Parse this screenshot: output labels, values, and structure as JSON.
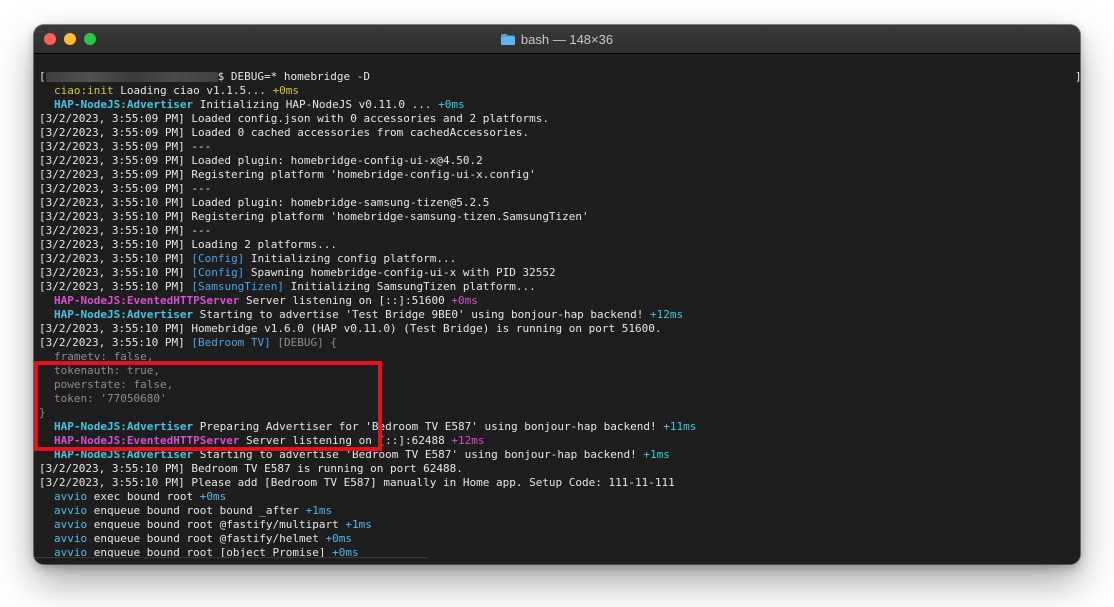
{
  "window": {
    "title": "bash — 148×36",
    "icons": {
      "folder": "folder-icon",
      "close": "close-icon",
      "minimize": "minimize-icon",
      "maximize": "maximize-icon"
    },
    "colors": {
      "highlight": "#e2131f",
      "background": "#1e1e1e"
    }
  },
  "terminal": {
    "prompt_command": "$ DEBUG=* homebridge -D",
    "right_bracket": "]",
    "lines": [
      {
        "indent": true,
        "parts": [
          {
            "t": "ciao:init",
            "c": "c-ciao"
          },
          {
            "t": " Loading ciao v1.1.5... "
          },
          {
            "t": "+0ms",
            "c": "c-ms-y"
          }
        ]
      },
      {
        "indent": true,
        "parts": [
          {
            "t": "HAP-NodeJS:Advertiser",
            "c": "c-adv"
          },
          {
            "t": " Initializing HAP-NodeJS v0.11.0 ... "
          },
          {
            "t": "+0ms",
            "c": "c-ms-c"
          }
        ]
      },
      {
        "parts": [
          {
            "t": "[3/2/2023, 3:55:09 PM] Loaded config.json with 0 accessories and 2 platforms."
          }
        ]
      },
      {
        "parts": [
          {
            "t": "[3/2/2023, 3:55:09 PM] Loaded 0 cached accessories from cachedAccessories."
          }
        ]
      },
      {
        "parts": [
          {
            "t": "[3/2/2023, 3:55:09 PM] ---"
          }
        ]
      },
      {
        "parts": [
          {
            "t": "[3/2/2023, 3:55:09 PM] Loaded plugin: homebridge-config-ui-x@4.50.2"
          }
        ]
      },
      {
        "parts": [
          {
            "t": "[3/2/2023, 3:55:09 PM] Registering platform 'homebridge-config-ui-x.config'"
          }
        ]
      },
      {
        "parts": [
          {
            "t": "[3/2/2023, 3:55:09 PM] ---"
          }
        ]
      },
      {
        "parts": [
          {
            "t": "[3/2/2023, 3:55:10 PM] Loaded plugin: homebridge-samsung-tizen@5.2.5"
          }
        ]
      },
      {
        "parts": [
          {
            "t": "[3/2/2023, 3:55:10 PM] Registering platform 'homebridge-samsung-tizen.SamsungTizen'"
          }
        ]
      },
      {
        "parts": [
          {
            "t": "[3/2/2023, 3:55:10 PM] ---"
          }
        ]
      },
      {
        "parts": [
          {
            "t": "[3/2/2023, 3:55:10 PM] Loading 2 platforms..."
          }
        ]
      },
      {
        "parts": [
          {
            "t": "[3/2/2023, 3:55:10 PM] "
          },
          {
            "t": "[Config]",
            "c": "c-cfg"
          },
          {
            "t": " Initializing config platform..."
          }
        ]
      },
      {
        "parts": [
          {
            "t": "[3/2/2023, 3:55:10 PM] "
          },
          {
            "t": "[Config]",
            "c": "c-cfg"
          },
          {
            "t": " Spawning homebridge-config-ui-x with PID 32552"
          }
        ]
      },
      {
        "parts": [
          {
            "t": "[3/2/2023, 3:55:10 PM] "
          },
          {
            "t": "[SamsungTizen]",
            "c": "c-cfg"
          },
          {
            "t": " Initializing SamsungTizen platform..."
          }
        ]
      },
      {
        "indent": true,
        "parts": [
          {
            "t": "HAP-NodeJS:EventedHTTPServer",
            "c": "c-evt"
          },
          {
            "t": " Server listening on [::]:51600 "
          },
          {
            "t": "+0ms",
            "c": "c-ms-m"
          }
        ]
      },
      {
        "indent": true,
        "parts": [
          {
            "t": "HAP-NodeJS:Advertiser",
            "c": "c-adv"
          },
          {
            "t": " Starting to advertise 'Test Bridge 9BE0' using bonjour-hap backend! "
          },
          {
            "t": "+12ms",
            "c": "c-ms-c"
          }
        ]
      },
      {
        "parts": [
          {
            "t": "[3/2/2023, 3:55:10 PM] Homebridge v1.6.0 (HAP v0.11.0) (Test Bridge) is running on port 51600."
          }
        ]
      },
      {
        "parts": [
          {
            "t": "[3/2/2023, 3:55:10 PM] "
          },
          {
            "t": "[Bedroom TV]",
            "c": "c-cfg"
          },
          {
            "t": " [DEBUG] {",
            "c": "c-gray"
          }
        ]
      },
      {
        "indent": true,
        "parts": [
          {
            "t": "frametv: false,",
            "c": "c-gray"
          }
        ]
      },
      {
        "indent": true,
        "parts": [
          {
            "t": "tokenauth: true,",
            "c": "c-gray"
          }
        ]
      },
      {
        "indent": true,
        "parts": [
          {
            "t": "powerstate: false,",
            "c": "c-gray"
          }
        ]
      },
      {
        "indent": true,
        "parts": [
          {
            "t": "token: '77050680'",
            "c": "c-gray"
          }
        ]
      },
      {
        "parts": [
          {
            "t": "}",
            "c": "c-gray"
          }
        ]
      },
      {
        "indent": true,
        "parts": [
          {
            "t": "HAP-NodeJS:Advertiser",
            "c": "c-adv"
          },
          {
            "t": " Preparing Advertiser for 'Bedroom TV E587' using bonjour-hap backend! "
          },
          {
            "t": "+11ms",
            "c": "c-ms-c"
          }
        ]
      },
      {
        "indent": true,
        "parts": [
          {
            "t": "HAP-NodeJS:EventedHTTPServer",
            "c": "c-evt"
          },
          {
            "t": " Server listening on [::]:62488 "
          },
          {
            "t": "+12ms",
            "c": "c-ms-m"
          }
        ]
      },
      {
        "indent": true,
        "parts": [
          {
            "t": "HAP-NodeJS:Advertiser",
            "c": "c-adv"
          },
          {
            "t": " Starting to advertise 'Bedroom TV E587' using bonjour-hap backend! "
          },
          {
            "t": "+1ms",
            "c": "c-ms-c"
          }
        ]
      },
      {
        "parts": [
          {
            "t": "[3/2/2023, 3:55:10 PM] Bedroom TV E587 is running on port 62488."
          }
        ]
      },
      {
        "parts": [
          {
            "t": "[3/2/2023, 3:55:10 PM] Please add [Bedroom TV E587] manually in Home app. Setup Code: 111-11-111"
          }
        ]
      },
      {
        "indent": true,
        "parts": [
          {
            "t": "avvio",
            "c": "c-avvio"
          },
          {
            "t": " exec bound root "
          },
          {
            "t": "+0ms",
            "c": "c-ms-b"
          }
        ]
      },
      {
        "indent": true,
        "parts": [
          {
            "t": "avvio",
            "c": "c-avvio"
          },
          {
            "t": " enqueue bound root bound _after "
          },
          {
            "t": "+1ms",
            "c": "c-ms-b"
          }
        ]
      },
      {
        "indent": true,
        "parts": [
          {
            "t": "avvio",
            "c": "c-avvio"
          },
          {
            "t": " enqueue bound root @fastify/multipart "
          },
          {
            "t": "+1ms",
            "c": "c-ms-b"
          }
        ]
      },
      {
        "indent": true,
        "parts": [
          {
            "t": "avvio",
            "c": "c-avvio"
          },
          {
            "t": " enqueue bound root @fastify/helmet "
          },
          {
            "t": "+0ms",
            "c": "c-ms-b"
          }
        ]
      },
      {
        "indent": true,
        "parts": [
          {
            "t": "avvio",
            "c": "c-avvio"
          },
          {
            "t": " enqueue bound root [object Promise] "
          },
          {
            "t": "+0ms",
            "c": "c-ms-b"
          }
        ]
      }
    ]
  }
}
